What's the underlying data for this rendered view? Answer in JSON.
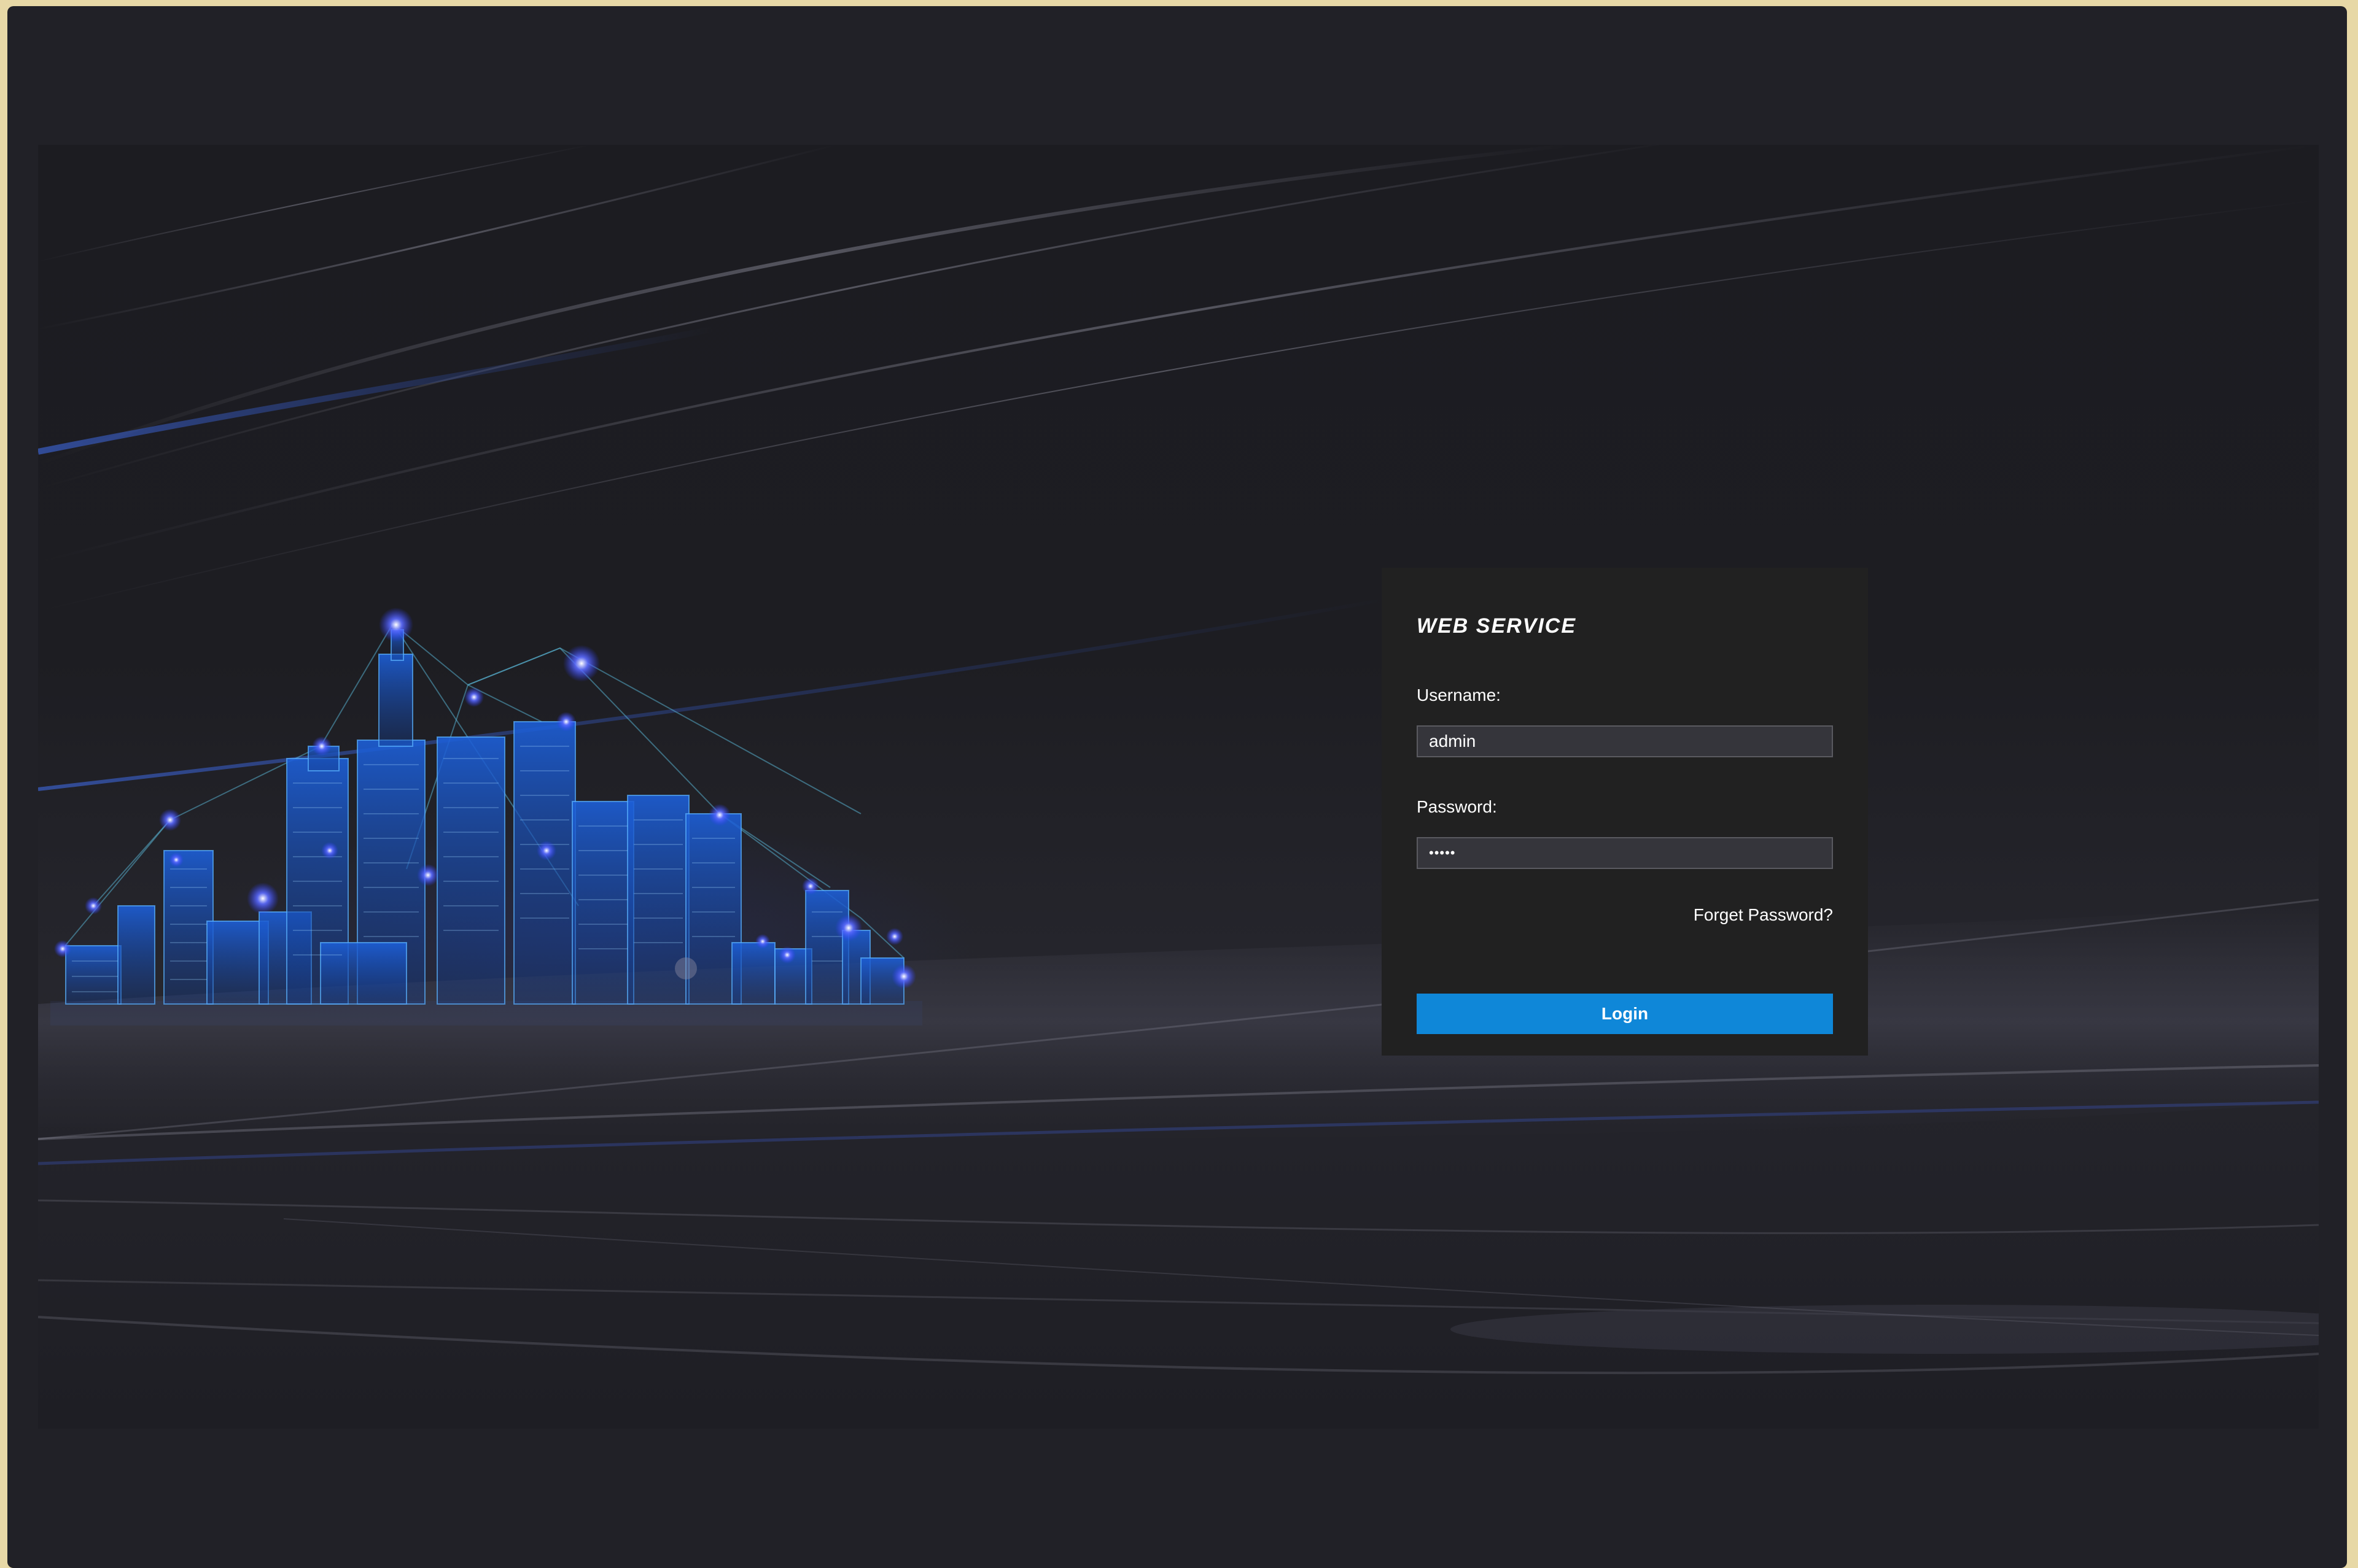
{
  "login": {
    "title": "WEB SERVICE",
    "username_label": "Username:",
    "username_value": "admin",
    "password_label": "Password:",
    "password_value": "•••••",
    "forget_link": "Forget Password?",
    "login_button": "Login"
  },
  "colors": {
    "page_background": "#212127",
    "card_background": "#212121",
    "button_accent": "#0f87d8",
    "outer_frame": "#e7d8a6"
  },
  "illustration": {
    "subject": "blue wireframe city skyline illustration"
  }
}
